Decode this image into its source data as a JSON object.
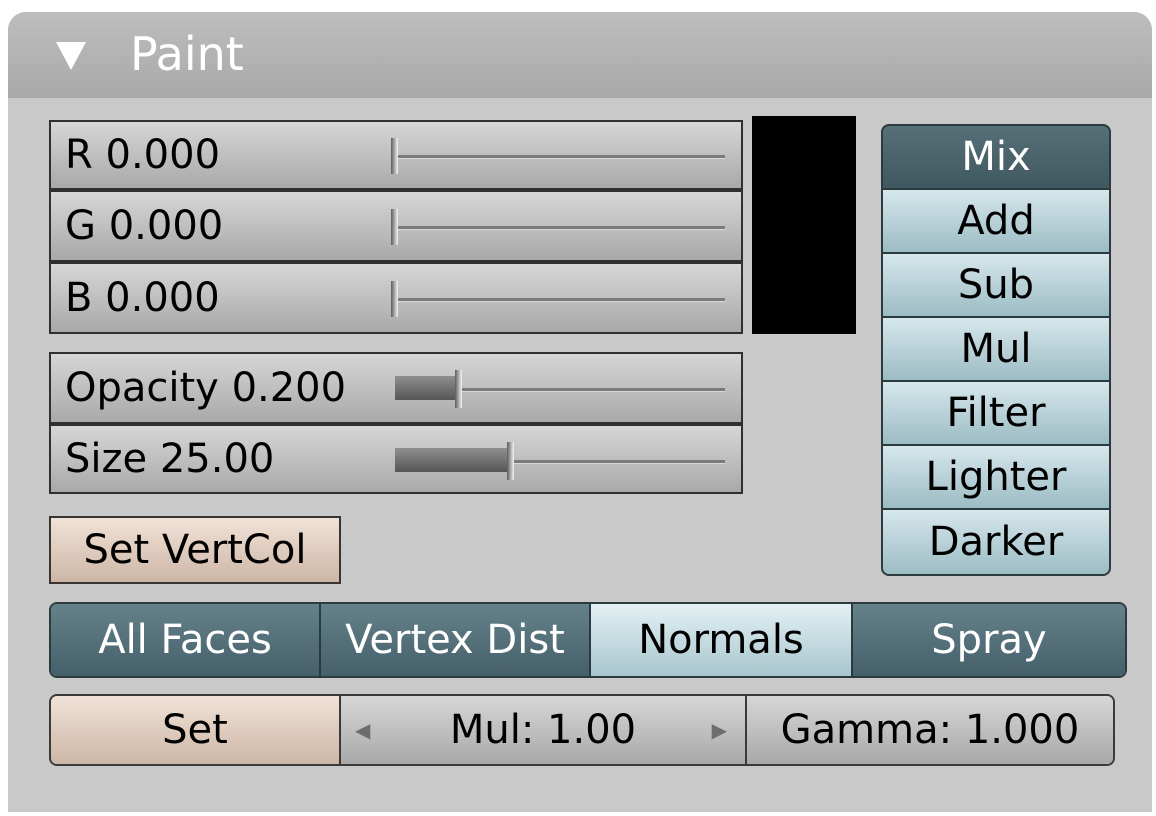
{
  "panel": {
    "title": "Paint",
    "collapse_icon": "triangle-down-icon"
  },
  "color_sliders": [
    {
      "name": "R",
      "value": "0.000",
      "level": 0.0
    },
    {
      "name": "G",
      "value": "0.000",
      "level": 0.0
    },
    {
      "name": "B",
      "value": "0.000",
      "level": 0.0
    }
  ],
  "color_swatch": "#000000",
  "opacity": {
    "label": "Opacity 0.200",
    "level": 0.2
  },
  "size": {
    "label": "Size 25.00",
    "level": 0.25
  },
  "set_vertcol_label": "Set VertCol",
  "blend_modes": {
    "selected": "Mix",
    "items": [
      "Mix",
      "Add",
      "Sub",
      "Mul",
      "Filter",
      "Lighter",
      "Darker"
    ]
  },
  "face_options": [
    {
      "label": "All Faces",
      "active": true
    },
    {
      "label": "Vertex Dist",
      "active": true
    },
    {
      "label": "Normals",
      "active": false
    },
    {
      "label": "Spray",
      "active": true
    }
  ],
  "bottom": {
    "set_label": "Set",
    "mul_label": "Mul: 1.00",
    "gamma_label": "Gamma: 1.000"
  }
}
